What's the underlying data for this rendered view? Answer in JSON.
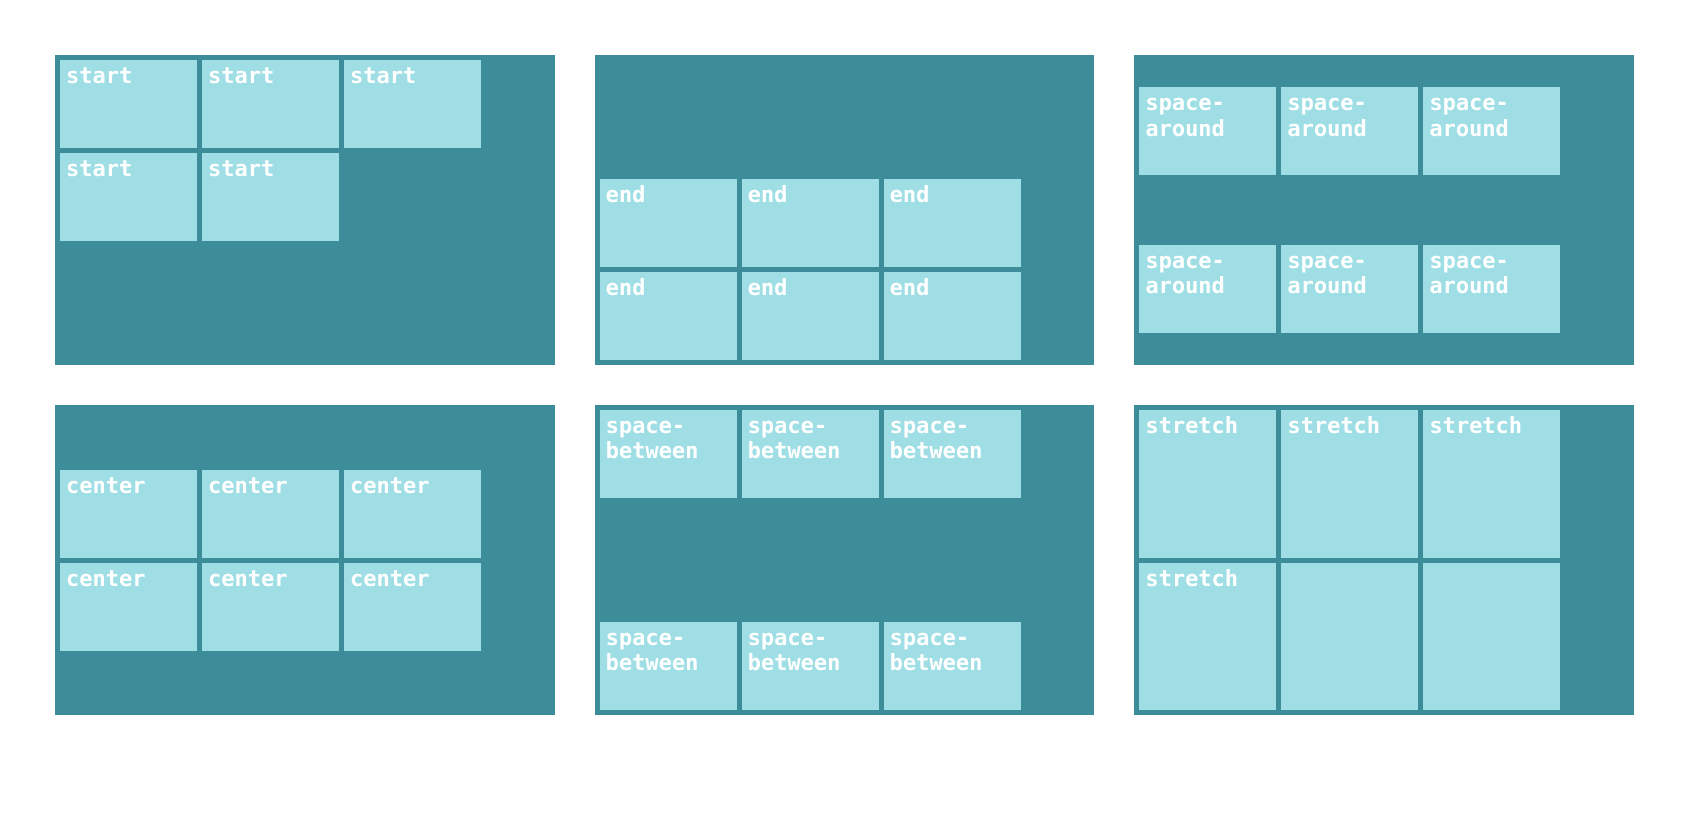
{
  "panels": [
    {
      "align": "start",
      "items": [
        "start",
        "start",
        "start",
        "start",
        "start"
      ]
    },
    {
      "align": "end",
      "items": [
        "end",
        "end",
        "end",
        "end",
        "end",
        "end"
      ]
    },
    {
      "align": "space-around",
      "items": [
        "space-around",
        "space-around",
        "space-around",
        "space-around",
        "space-around",
        "space-around"
      ]
    },
    {
      "align": "center",
      "items": [
        "center",
        "center",
        "center",
        "center",
        "center",
        "center"
      ]
    },
    {
      "align": "space-between",
      "items": [
        "space-between",
        "space-between",
        "space-between",
        "space-between",
        "space-between",
        "space-between"
      ]
    },
    {
      "align": "stretch",
      "items": [
        "stretch",
        "stretch",
        "stretch",
        "stretch",
        "",
        ""
      ]
    }
  ]
}
